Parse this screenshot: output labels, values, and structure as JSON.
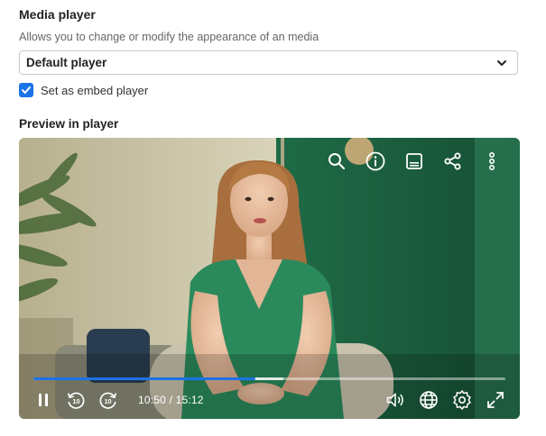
{
  "media_player": {
    "title": "Media player",
    "description": "Allows you to change or modify the appearance of an media",
    "select": {
      "value": "Default player"
    },
    "embed_checkbox": {
      "label": "Set as embed player",
      "checked": true
    }
  },
  "preview": {
    "title": "Preview in player",
    "current_time": "10:50",
    "duration": "15:12",
    "time_display": "10:50 / 15:12",
    "progress_fraction": 0.47,
    "buffered_fraction": 0.53,
    "skip_seconds": "10",
    "top_icons": [
      "search-icon",
      "info-icon",
      "subtitles-icon",
      "share-icon",
      "more-vertical-icon"
    ],
    "bottom_icons": [
      "pause-icon",
      "rewind-10-icon",
      "forward-10-icon",
      "volume-icon",
      "globe-icon",
      "settings-icon",
      "fullscreen-icon"
    ]
  },
  "colors": {
    "accent": "#1a73e8",
    "wall_green": "#1f6b47",
    "dress_green": "#2b8a5c"
  }
}
